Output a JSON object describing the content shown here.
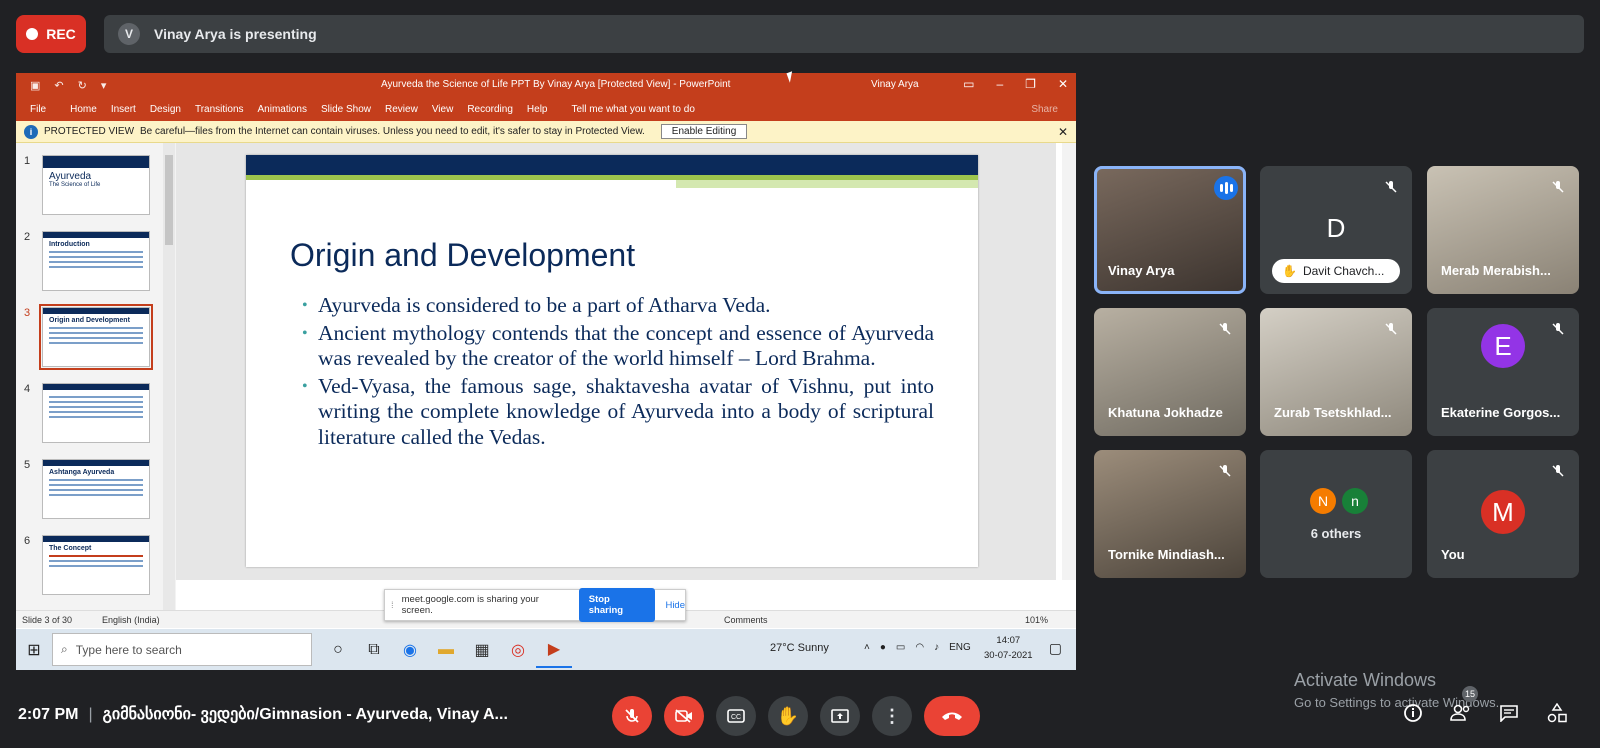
{
  "meet": {
    "rec_label": "REC",
    "presenter_initial": "V",
    "presenting_text": "Vinay Arya is presenting",
    "time": "2:07 PM",
    "meeting_title": "გიმნასიონი- ვედები/Gimnasion - Ayurveda, Vinay A...",
    "participants_badge": "15",
    "activate_title": "Activate Windows",
    "activate_sub": "Go to Settings to activate Windows."
  },
  "tiles": [
    {
      "name": "Vinay Arya",
      "speaking": true
    },
    {
      "name": "Davit Chavch...",
      "initial": "D",
      "color": "#5c6bc0",
      "hand_raised": true
    },
    {
      "name": "Merab Merabish..."
    },
    {
      "name": "Khatuna Jokhadze"
    },
    {
      "name": "Zurab Tsetskhlad..."
    },
    {
      "name": "Ekaterine Gorgos...",
      "initial": "E",
      "color": "#9334e6"
    },
    {
      "name": "Tornike Mindiash..."
    },
    {
      "others_label": "6 others",
      "initials": [
        "N",
        "n"
      ],
      "colors": [
        "#f57c00",
        "#188038"
      ]
    },
    {
      "name": "You",
      "initial": "M",
      "color": "#d93025"
    }
  ],
  "ppt": {
    "doc_title": "Ayurveda the Science of Life PPT By Vinay Arya [Protected View] - PowerPoint",
    "user": "Vinay Arya",
    "tabs": [
      "File",
      "Home",
      "Insert",
      "Design",
      "Transitions",
      "Animations",
      "Slide Show",
      "Review",
      "View",
      "Recording",
      "Help"
    ],
    "tell_me": "Tell me what you want to do",
    "share": "Share",
    "protected_label": "PROTECTED VIEW",
    "protected_msg": "Be careful—files from the Internet can contain viruses. Unless you need to edit, it's safer to stay in Protected View.",
    "enable_editing": "Enable Editing",
    "thumbs": [
      {
        "num": "1",
        "title": "Ayurveda"
      },
      {
        "num": "2",
        "title": "Introduction"
      },
      {
        "num": "3",
        "title": "Origin and Development"
      },
      {
        "num": "4",
        "title": ""
      },
      {
        "num": "5",
        "title": "Ashtanga Ayurveda"
      },
      {
        "num": "6",
        "title": "The Concept"
      }
    ],
    "thumb1_sub": "The Science of Life",
    "slide": {
      "title": "Origin and Development",
      "bullets": [
        "Ayurveda is considered to be a part of Atharva Veda.",
        "Ancient mythology contends that the concept and essence of Ayurveda was revealed by the creator of the world himself – Lord Brahma.",
        "Ved-Vyasa, the famous sage, shaktavesha avatar of Vishnu, put into writing the complete knowledge of Ayurveda into a body of scriptural literature called the Vedas."
      ]
    },
    "status_slide": "Slide 3 of 30",
    "status_lang": "English (India)",
    "comments": "Comments",
    "zoom": "101%"
  },
  "sharebar": {
    "text": "meet.google.com is sharing your screen.",
    "stop": "Stop sharing",
    "hide": "Hide"
  },
  "taskbar": {
    "search_placeholder": "Type here to search",
    "weather": "27°C  Sunny",
    "lang": "ENG",
    "clock_time": "14:07",
    "clock_date": "30-07-2021"
  }
}
